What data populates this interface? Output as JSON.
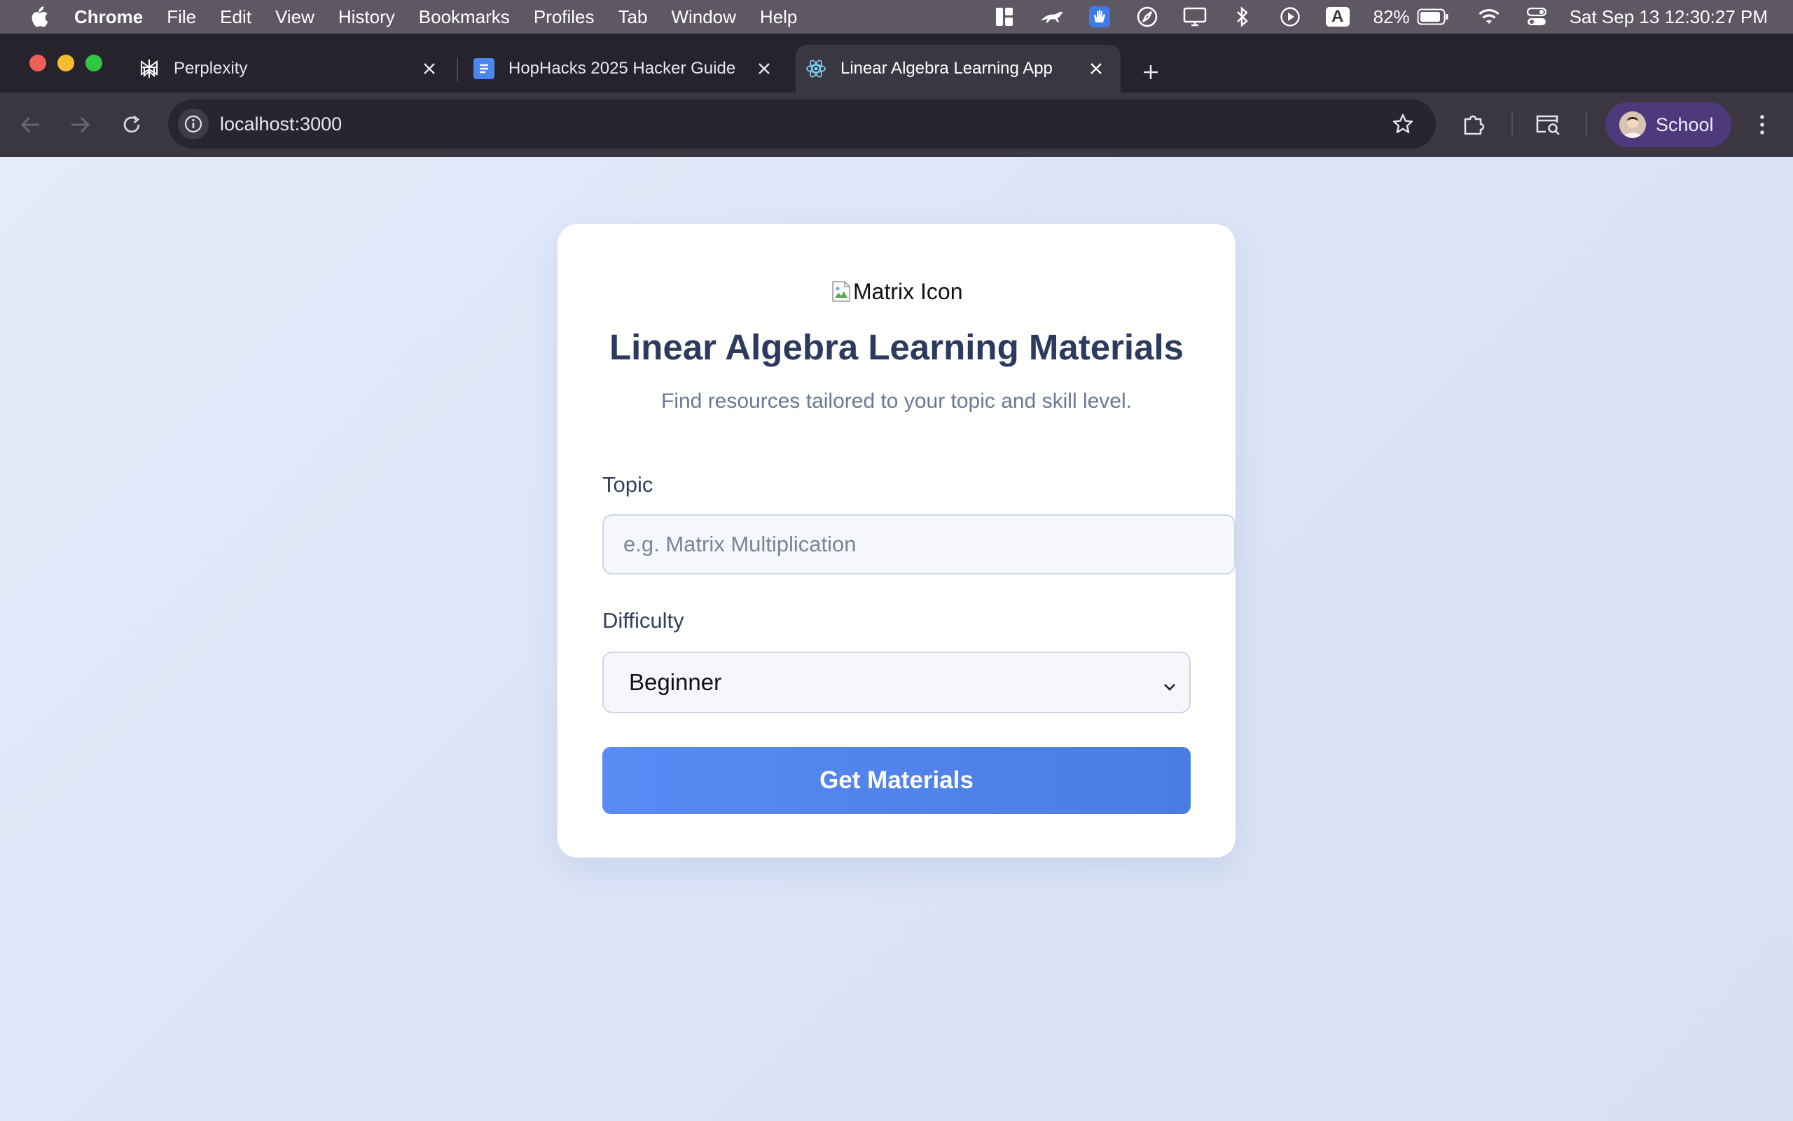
{
  "menubar": {
    "app_name": "Chrome",
    "items": [
      "File",
      "Edit",
      "View",
      "History",
      "Bookmarks",
      "Profiles",
      "Tab",
      "Window",
      "Help"
    ],
    "status_icons": [
      "widgets-icon",
      "cheetah-icon",
      "hand-icon",
      "compass-icon",
      "display-icon",
      "bluetooth-icon",
      "play-icon"
    ],
    "input_source": "A",
    "battery_percent": "82%",
    "datetime": "Sat Sep 13  12:30:27 PM"
  },
  "browser": {
    "tabs": [
      {
        "title": "Perplexity",
        "icon": "perplexity-icon",
        "active": false
      },
      {
        "title": "HopHacks 2025 Hacker Guide",
        "icon": "google-docs-icon",
        "active": false
      },
      {
        "title": "Linear Algebra Learning App",
        "icon": "react-icon",
        "active": true
      }
    ],
    "url": "localhost:3000",
    "profile_label": "School"
  },
  "page": {
    "image_alt": "Matrix Icon",
    "title": "Linear Algebra Learning Materials",
    "subtitle": "Find resources tailored to your topic and skill level.",
    "topic_label": "Topic",
    "topic_placeholder": "e.g. Matrix Multiplication",
    "topic_value": "",
    "difficulty_label": "Difficulty",
    "difficulty_selected": "Beginner",
    "submit_label": "Get Materials"
  },
  "colors": {
    "accent": "#5a8af5",
    "title": "#2b3a5e",
    "background": "#dde5f7"
  }
}
